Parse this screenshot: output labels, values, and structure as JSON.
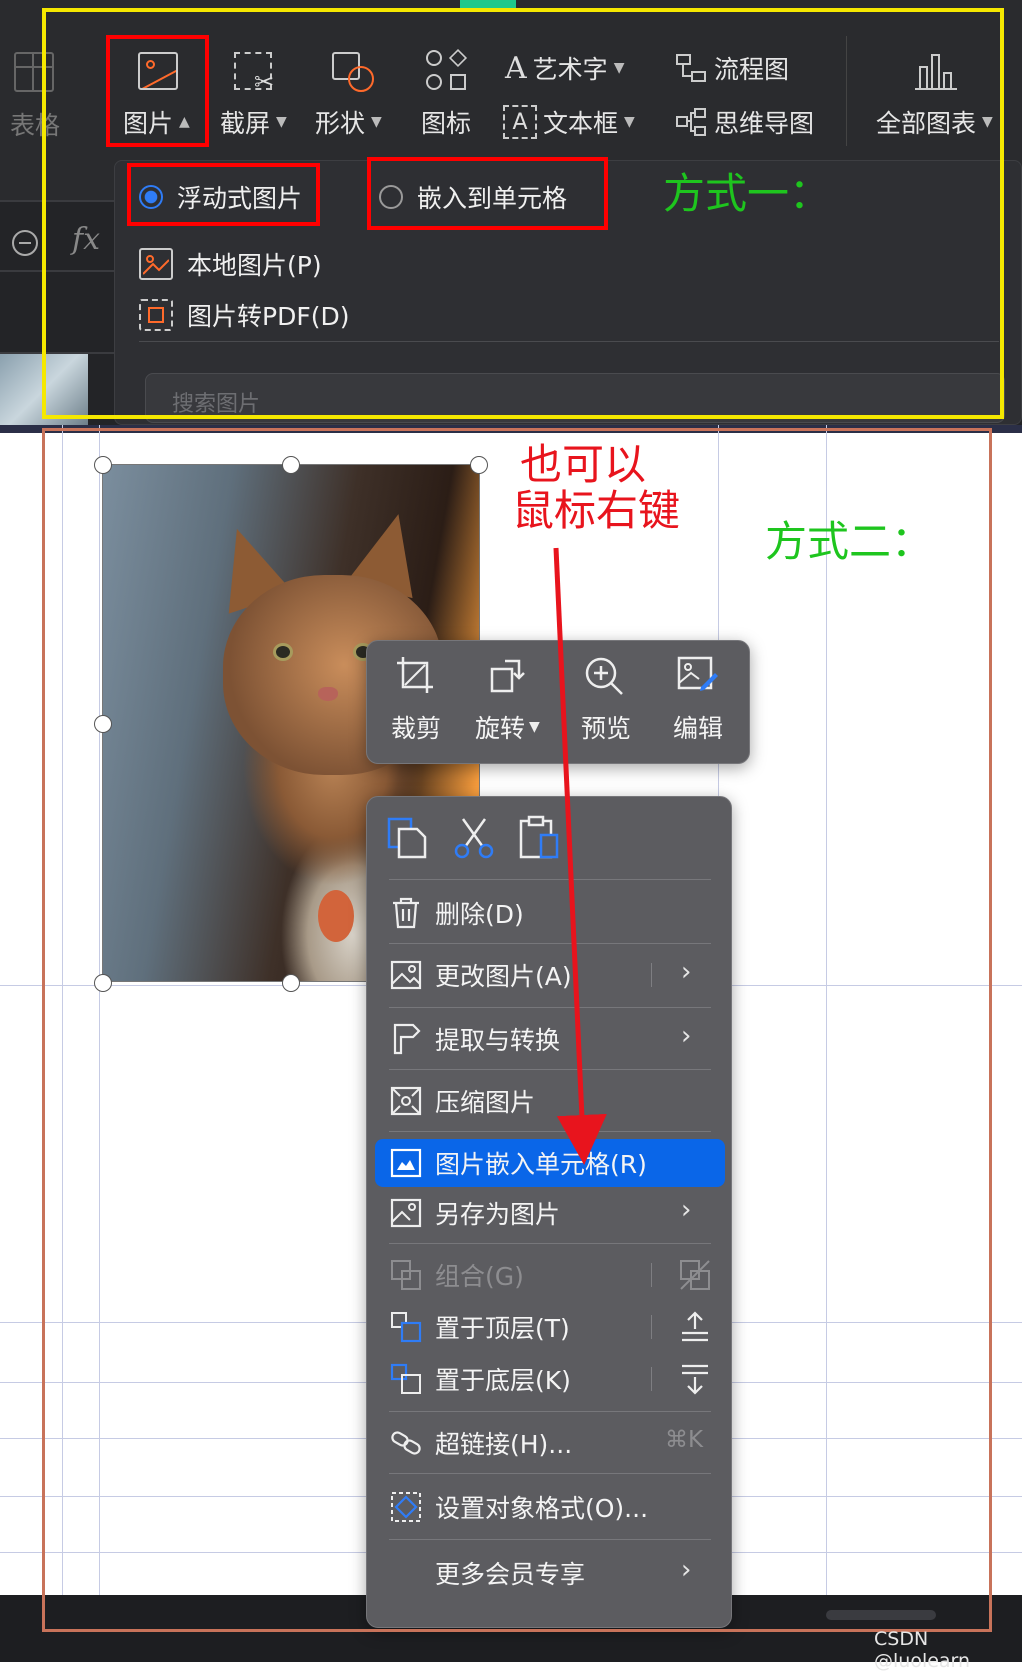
{
  "toolbar": {
    "table_label": "表格",
    "picture_label": "图片",
    "screenshot_label": "截屏",
    "shapes_label": "形状",
    "icons_label": "图标",
    "wordart_label": "艺术字",
    "flowchart_label": "流程图",
    "textbox_label": "文本框",
    "mindmap_label": "思维导图",
    "all_charts_label": "全部图表"
  },
  "formula_bar": {
    "fx": "fx"
  },
  "insert_menu": {
    "floating_label": "浮动式图片",
    "embed_label": "嵌入到单元格",
    "local_label": "本地图片(P)",
    "to_pdf_label": "图片转PDF(D)",
    "search_placeholder": "搜索图片"
  },
  "image_toolbar": {
    "crop": "裁剪",
    "rotate": "旋转",
    "preview": "预览",
    "edit": "编辑"
  },
  "context_menu": {
    "delete": "删除(D)",
    "change_picture": "更改图片(A)",
    "extract_convert": "提取与转换",
    "compress": "压缩图片",
    "embed_in_cell": "图片嵌入单元格(R)",
    "save_as_picture": "另存为图片",
    "group": "组合(G)",
    "bring_to_front": "置于顶层(T)",
    "send_to_back": "置于底层(K)",
    "hyperlink": "超链接(H)...",
    "hyperlink_shortcut": "⌘K",
    "format_object": "设置对象格式(O)...",
    "more_vip": "更多会员专享"
  },
  "annotations": {
    "method1": "方式一：",
    "method2": "方式二：",
    "right_click_line1": "也可以",
    "right_click_line2": "鼠标右键"
  },
  "watermark": "CSDN @luolearn",
  "colors": {
    "highlight_box": "#ff0000",
    "yellow_frame": "#f5e800",
    "orange_frame": "#c8735a",
    "selected_item": "#0a66e8",
    "green_note": "#1ec51e",
    "red_note": "#e8141d"
  }
}
